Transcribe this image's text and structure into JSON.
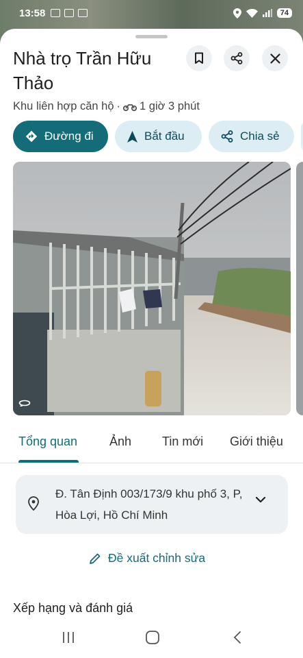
{
  "status_bar": {
    "time": "13:58",
    "battery": "74"
  },
  "place": {
    "name": "Nhà trọ Trần Hữu Thảo",
    "category": "Khu liên hợp căn hộ",
    "separator": "·",
    "travel_time": "1 giờ 3 phút"
  },
  "header_icons": {
    "save": "bookmark-icon",
    "share": "share-icon",
    "close": "close-icon"
  },
  "actions": [
    {
      "label": "Đường đi",
      "icon": "directions-icon"
    },
    {
      "label": "Bắt đầu",
      "icon": "navigation-arrow-icon"
    },
    {
      "label": "Chia sẻ",
      "icon": "share-icon"
    }
  ],
  "tabs": [
    {
      "label": "Tổng quan",
      "active": true
    },
    {
      "label": "Ảnh",
      "active": false
    },
    {
      "label": "Tin mới",
      "active": false
    },
    {
      "label": "Giới thiệu",
      "active": false
    }
  ],
  "address": {
    "text": "Đ. Tân Định 003/173/9 khu phố 3, P, Hòa Lợi, Hồ Chí Minh"
  },
  "suggest_edit": {
    "label": "Đề xuất chỉnh sửa"
  },
  "ratings_section": {
    "title": "Xếp hạng và đánh giá"
  },
  "colors": {
    "primary": "#136c78",
    "chip_secondary": "#dceef3",
    "address_bg": "#edf1f3"
  }
}
